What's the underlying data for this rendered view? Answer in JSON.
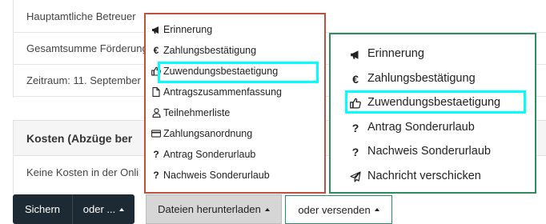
{
  "form": {
    "rows": [
      "Hauptamtliche Betreuer",
      "Gesamtsumme Förderung",
      "Zeitraum: 11. September"
    ],
    "costs_title": "Kosten (Abzüge ber",
    "costs_text": "Keine Kosten in der Onli"
  },
  "toolbar": {
    "save_label": "Sichern",
    "more_label": "oder ...",
    "download_label": "Dateien herunterladen",
    "send_label": "oder versenden"
  },
  "download_menu": {
    "items": [
      {
        "label": "Erinnerung",
        "icon": "bullhorn-icon"
      },
      {
        "label": "Zahlungsbestätigung",
        "icon": "euro-icon"
      },
      {
        "label": "Zuwendungsbestaetigung",
        "icon": "thumbs-up-icon"
      },
      {
        "label": "Antragszusammenfassung",
        "icon": "document-icon"
      },
      {
        "label": "Teilnehmerliste",
        "icon": "user-icon"
      },
      {
        "label": "Zahlungsanordnung",
        "icon": "credit-card-icon"
      },
      {
        "label": "Antrag Sonderurlaub",
        "icon": "question-icon"
      },
      {
        "label": "Nachweis Sonderurlaub",
        "icon": "question-icon"
      }
    ]
  },
  "send_menu": {
    "items": [
      {
        "label": "Erinnerung",
        "icon": "bullhorn-icon"
      },
      {
        "label": "Zahlungsbestätigung",
        "icon": "euro-icon"
      },
      {
        "label": "Zuwendungsbestaetigung",
        "icon": "thumbs-up-icon"
      },
      {
        "label": "Antrag Sonderurlaub",
        "icon": "question-icon"
      },
      {
        "label": "Nachweis Sonderurlaub",
        "icon": "question-icon"
      },
      {
        "label": "Nachricht verschicken",
        "icon": "paper-plane-icon"
      }
    ]
  },
  "colors": {
    "download_menu_border": "#c0503f",
    "send_menu_border": "#2e8b62",
    "highlight": "#00ffff",
    "dark_button": "#1e2a33"
  }
}
